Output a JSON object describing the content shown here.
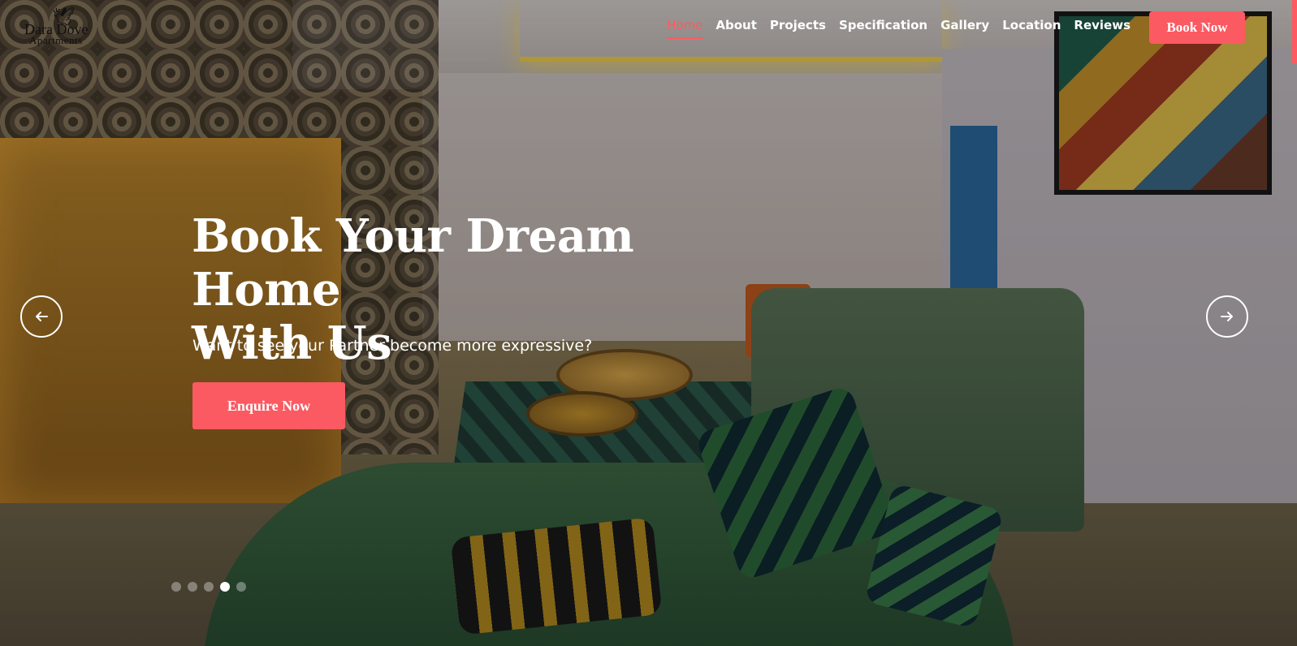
{
  "brand": {
    "logo_line1": "Dara Dove",
    "logo_line2": "Apartments"
  },
  "nav": {
    "items": [
      {
        "label": "Home",
        "active": true
      },
      {
        "label": "About",
        "active": false
      },
      {
        "label": "Projects",
        "active": false
      },
      {
        "label": "Specification",
        "active": false
      },
      {
        "label": "Gallery",
        "active": false
      },
      {
        "label": "Location",
        "active": false
      },
      {
        "label": "Reviews",
        "active": false
      }
    ],
    "cta_label": "Book Now"
  },
  "hero": {
    "title_line1": "Book Your Dream Home",
    "title_line2": "With Us",
    "subtitle": "Want to see your Partner become more expressive?",
    "button_label": "Enquire Now"
  },
  "carousel": {
    "prev_icon": "arrow-left-icon",
    "next_icon": "arrow-right-icon",
    "slide_count": 5,
    "active_slide": 4
  },
  "colors": {
    "accent": "#fb5a62",
    "nav_active": "#ff5a5f",
    "text": "#ffffff"
  }
}
